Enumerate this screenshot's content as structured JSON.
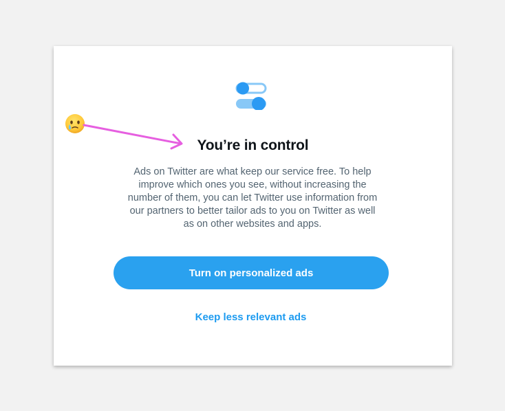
{
  "dialog": {
    "title": "You’re in control",
    "body_lines": [
      "Ads on Twitter are what keep our service free. To help",
      "improve which ones you see, without increasing the",
      "number of them, you can let Twitter use information from",
      "our partners to better tailor ads to you on Twitter as well",
      "as on other websites and apps."
    ],
    "primary_button_label": "Turn on personalized ads",
    "secondary_link_label": "Keep less relevant ads",
    "icon": "toggle-settings-icon"
  },
  "annotation": {
    "emoji": "crying-face-emoji",
    "arrow": "arrow-annotation",
    "arrow_color": "#e65fe0"
  },
  "colors": {
    "accent": "#1d9bf0",
    "button_bg": "#2aa1ef",
    "title": "#0f1419",
    "body": "#536471",
    "toggle_dark": "#2b9af3",
    "toggle_light": "#88c8f7"
  }
}
